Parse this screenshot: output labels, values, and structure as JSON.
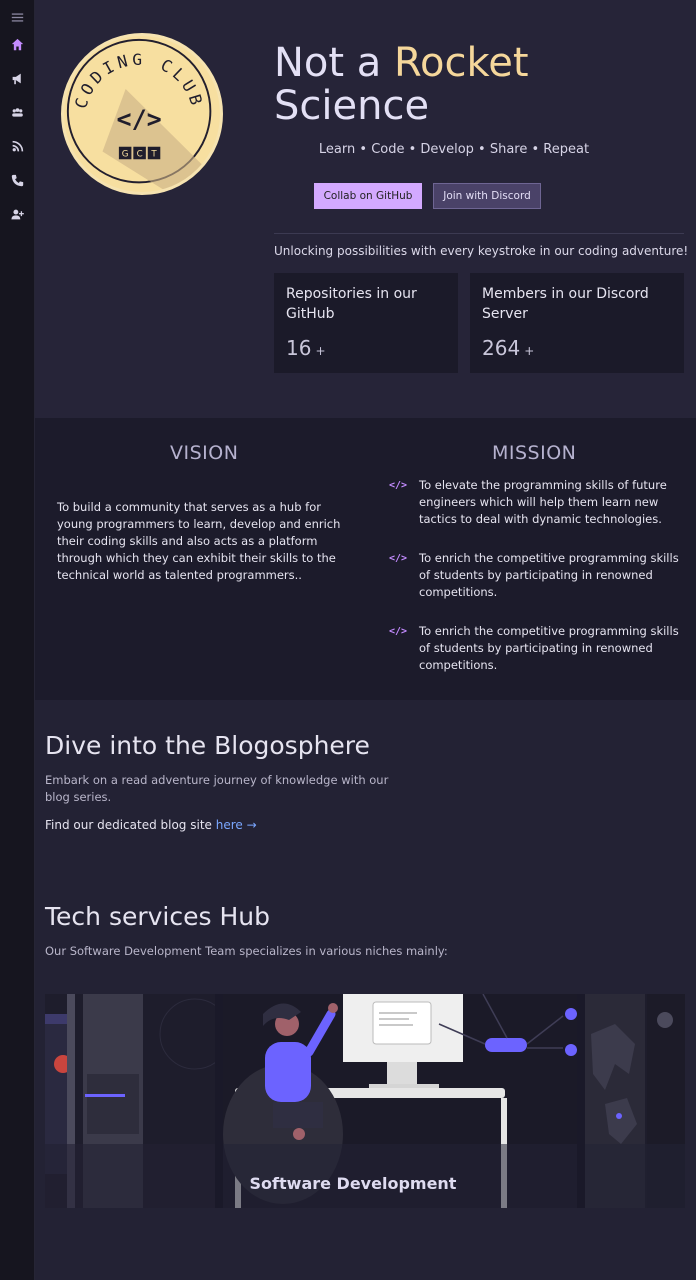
{
  "sidebar": {
    "items": [
      {
        "icon": "menu-icon"
      },
      {
        "icon": "home-icon"
      },
      {
        "icon": "announcement-icon"
      },
      {
        "icon": "team-icon"
      },
      {
        "icon": "blog-icon"
      },
      {
        "icon": "phone-icon"
      },
      {
        "icon": "add-user-icon"
      }
    ]
  },
  "logo": {
    "text_top": "CODING CLUB",
    "symbol": "</>",
    "letters": [
      "G",
      "C",
      "T"
    ]
  },
  "hero": {
    "title_part1": "Not a ",
    "title_accent": "Rocket",
    "title_part2": "Science",
    "tagline": "Learn • Code • Develop • Share • Repeat",
    "github_btn": "Collab on GitHub",
    "discord_btn": "Join with Discord",
    "subtagline": "Unlocking possibilities with every keystroke in our coding adventure!"
  },
  "stats": [
    {
      "label": "Repositories in our GitHub",
      "value": "16",
      "suffix": "+"
    },
    {
      "label": "Members in our Discord Server",
      "value": "264",
      "suffix": "+"
    }
  ],
  "vision": {
    "heading": "VISION",
    "text": "To build a community that serves as a hub for young programmers to learn, develop and enrich their coding skills and also acts as a platform through which they can exhibit their skills to the technical world as talented programmers.."
  },
  "mission": {
    "heading": "MISSION",
    "items": [
      "To elevate the programming skills of future engineers which will help them learn new tactics to deal with dynamic technologies.",
      "To enrich the competitive programming skills of students by participating in renowned competitions.",
      "To enrich the competitive programming skills of students by participating in renowned competitions."
    ]
  },
  "blog": {
    "heading": "Dive into the Blogosphere",
    "desc": "Embark on a read adventure journey of knowledge with our blog series.",
    "link_prefix": "Find our dedicated blog site ",
    "link_text": "here →"
  },
  "tech": {
    "heading": "Tech services Hub",
    "desc": "Our Software Development Team specializes in various niches mainly:",
    "card_title": "Software Development"
  },
  "colors": {
    "accent_gold": "#f5d79b",
    "accent_purple": "#d3a9ff",
    "link_blue": "#7aa7ff",
    "illustration_blue": "#6c63ff"
  }
}
